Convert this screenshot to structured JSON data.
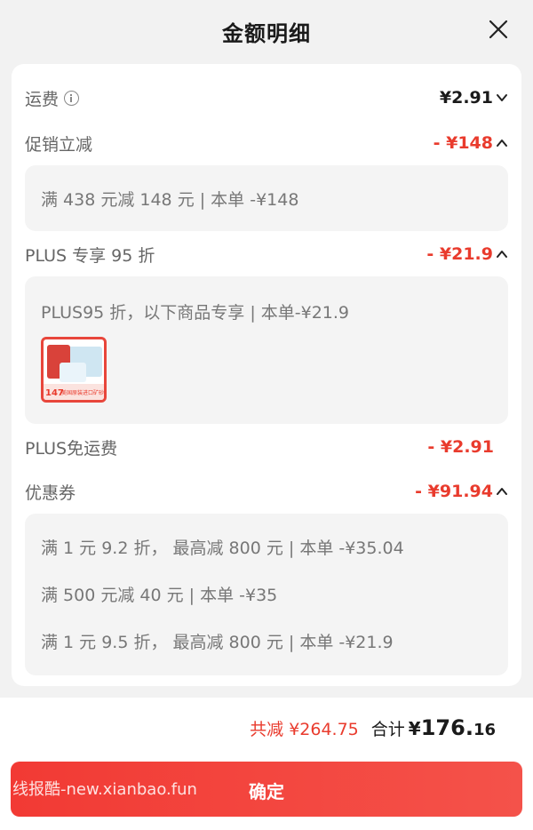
{
  "header": {
    "title": "金额明细"
  },
  "rows": {
    "shipping": {
      "label": "运费",
      "amount": "¥2.91"
    },
    "promo": {
      "label": "促销立减",
      "amount": "- ¥148",
      "details": [
        "满 438 元减 148 元 | 本单 -¥148"
      ]
    },
    "plus_discount": {
      "label": "PLUS 专享 95 折",
      "amount": "- ¥21.9",
      "details": [
        "PLUS95 折，以下商品专享 | 本单-¥21.9"
      ],
      "product": {
        "price": "147",
        "caption": "美国原装进口矿砂"
      }
    },
    "plus_free_ship": {
      "label": "PLUS免运费",
      "amount": "- ¥2.91"
    },
    "coupon": {
      "label": "优惠券",
      "amount": "- ¥91.94",
      "details": [
        "满 1 元 9.2 折， 最高减 800 元 | 本单 -¥35.04",
        "满 500 元减 40 元 | 本单 -¥35",
        "满 1 元 9.5 折， 最高减 800 元 | 本单 -¥21.9"
      ]
    }
  },
  "totals": {
    "reduced": "共减 ¥264.75",
    "sum_label": "合计",
    "sum_currency": "¥",
    "sum_int": "176.",
    "sum_dec": "16"
  },
  "confirm": {
    "label": "确定",
    "watermark": "线报酷-new.xianbao.fun"
  },
  "colors": {
    "accent": "#e93b2d",
    "button": "#f23a34"
  }
}
